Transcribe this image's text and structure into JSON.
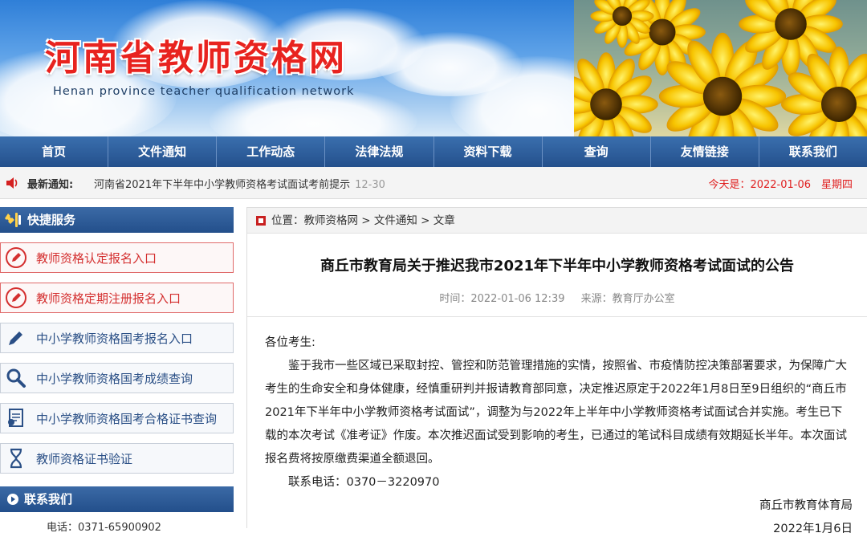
{
  "banner": {
    "title": "河南省教师资格网",
    "subtitle": "Henan province teacher qualification network"
  },
  "nav": [
    "首页",
    "文件通知",
    "工作动态",
    "法律法规",
    "资料下载",
    "查询",
    "友情链接",
    "联系我们"
  ],
  "notice": {
    "label": "最新通知:",
    "text": "河南省2021年下半年中小学教师资格考试面试考前提示",
    "date": "12-30",
    "today": "今天是：2022-01-06　星期四"
  },
  "sidebar": {
    "quick_title": "快捷服务",
    "buttons": [
      {
        "label": "教师资格认定报名入口",
        "icon": "pencil-circle-icon"
      },
      {
        "label": "教师资格定期注册报名入口",
        "icon": "pencil-circle-icon"
      },
      {
        "label": "中小学教师资格国考报名入口",
        "icon": "pencil-icon"
      },
      {
        "label": "中小学教师资格国考成绩查询",
        "icon": "search-icon"
      },
      {
        "label": "中小学教师资格国考合格证书查询",
        "icon": "certificate-icon"
      },
      {
        "label": "教师资格证书验证",
        "icon": "hourglass-icon"
      }
    ],
    "contact_title": "联系我们",
    "phone": "电话：0371-65900902"
  },
  "breadcrumb": "位置：教师资格网 > 文件通知 > 文章",
  "article": {
    "title": "商丘市教育局关于推迟我市2021年下半年中小学教师资格考试面试的公告",
    "time": "时间：2022-01-06 12:39",
    "source": "来源：教育厅办公室",
    "greeting": "各位考生:",
    "paragraph": "鉴于我市一些区域已采取封控、管控和防范管理措施的实情，按照省、市疫情防控决策部署要求，为保障广大考生的生命安全和身体健康，经慎重研判并报请教育部同意，决定推迟原定于2022年1月8日至9日组织的“商丘市2021年下半年中小学教师资格考试面试”，调整为与2022年上半年中小学教师资格考试面试合并实施。考生已下载的本次考试《准考证》作废。本次推迟面试受到影响的考生，已通过的笔试科目成绩有效期延长半年。本次面试报名费将按原缴费渠道全额退回。",
    "contact": "联系电话：0370－3220970",
    "signature": "商丘市教育体育局",
    "sign_date": "2022年1月6日"
  }
}
